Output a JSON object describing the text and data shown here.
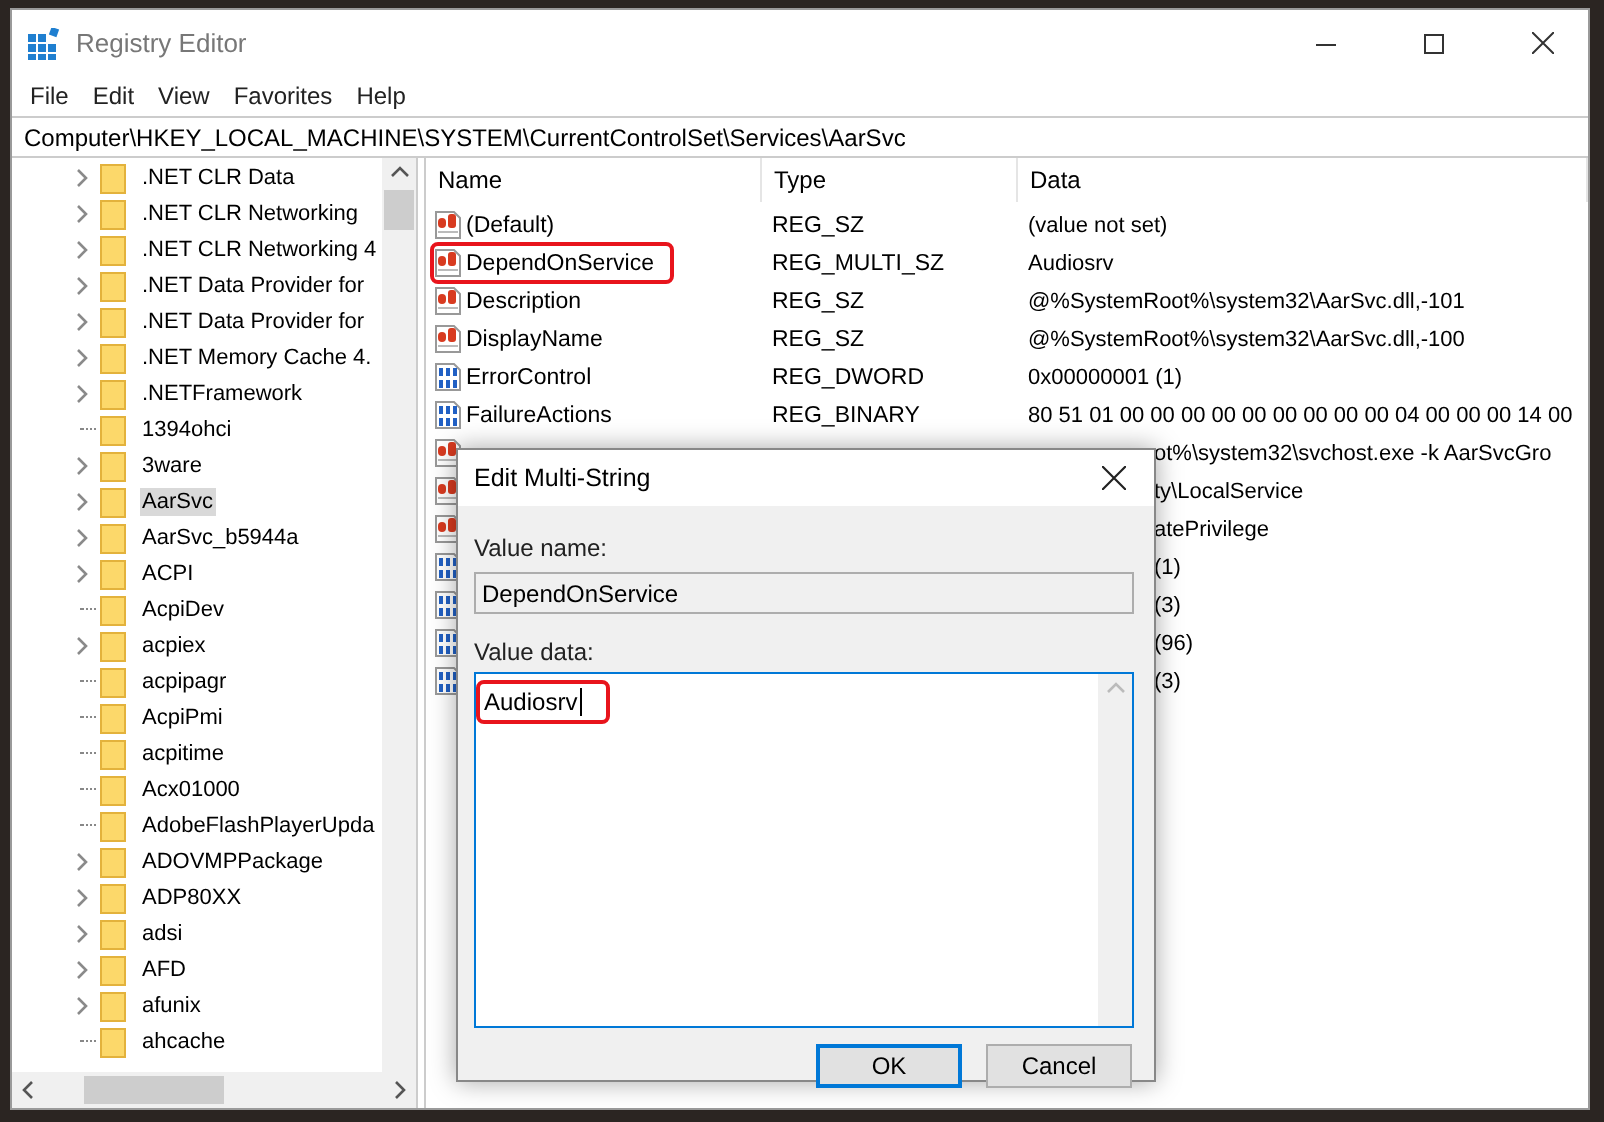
{
  "window": {
    "title": "Registry Editor"
  },
  "menu": [
    "File",
    "Edit",
    "View",
    "Favorites",
    "Help"
  ],
  "address": "Computer\\HKEY_LOCAL_MACHINE\\SYSTEM\\CurrentControlSet\\Services\\AarSvc",
  "tree": {
    "items": [
      {
        "label": ".NET CLR Data",
        "expandable": true,
        "selected": false
      },
      {
        "label": ".NET CLR Networking",
        "expandable": true,
        "selected": false
      },
      {
        "label": ".NET CLR Networking 4",
        "expandable": true,
        "selected": false
      },
      {
        "label": ".NET Data Provider for",
        "expandable": true,
        "selected": false
      },
      {
        "label": ".NET Data Provider for",
        "expandable": true,
        "selected": false
      },
      {
        "label": ".NET Memory Cache 4.",
        "expandable": true,
        "selected": false
      },
      {
        "label": ".NETFramework",
        "expandable": true,
        "selected": false
      },
      {
        "label": "1394ohci",
        "expandable": false,
        "selected": false
      },
      {
        "label": "3ware",
        "expandable": true,
        "selected": false
      },
      {
        "label": "AarSvc",
        "expandable": true,
        "selected": true
      },
      {
        "label": "AarSvc_b5944a",
        "expandable": true,
        "selected": false
      },
      {
        "label": "ACPI",
        "expandable": true,
        "selected": false
      },
      {
        "label": "AcpiDev",
        "expandable": false,
        "selected": false
      },
      {
        "label": "acpiex",
        "expandable": true,
        "selected": false
      },
      {
        "label": "acpipagr",
        "expandable": false,
        "selected": false
      },
      {
        "label": "AcpiPmi",
        "expandable": false,
        "selected": false
      },
      {
        "label": "acpitime",
        "expandable": false,
        "selected": false
      },
      {
        "label": "Acx01000",
        "expandable": false,
        "selected": false
      },
      {
        "label": "AdobeFlashPlayerUpda",
        "expandable": false,
        "selected": false
      },
      {
        "label": "ADOVMPPackage",
        "expandable": true,
        "selected": false
      },
      {
        "label": "ADP80XX",
        "expandable": true,
        "selected": false
      },
      {
        "label": "adsi",
        "expandable": true,
        "selected": false
      },
      {
        "label": "AFD",
        "expandable": true,
        "selected": false
      },
      {
        "label": "afunix",
        "expandable": true,
        "selected": false
      },
      {
        "label": "ahcache",
        "expandable": false,
        "selected": false
      }
    ]
  },
  "values": {
    "columns": [
      "Name",
      "Type",
      "Data"
    ],
    "rows": [
      {
        "kind": "string",
        "name": "(Default)",
        "type": "REG_SZ",
        "data": "(value not set)",
        "highlighted": false
      },
      {
        "kind": "string",
        "name": "DependOnService",
        "type": "REG_MULTI_SZ",
        "data": "Audiosrv",
        "highlighted": true
      },
      {
        "kind": "string",
        "name": "Description",
        "type": "REG_SZ",
        "data": "@%SystemRoot%\\system32\\AarSvc.dll,-101",
        "highlighted": false
      },
      {
        "kind": "string",
        "name": "DisplayName",
        "type": "REG_SZ",
        "data": "@%SystemRoot%\\system32\\AarSvc.dll,-100",
        "highlighted": false
      },
      {
        "kind": "binary",
        "name": "ErrorControl",
        "type": "REG_DWORD",
        "data": "0x00000001 (1)",
        "highlighted": false
      },
      {
        "kind": "binary",
        "name": "FailureActions",
        "type": "REG_BINARY",
        "data": "80 51 01 00 00 00 00 00 00 00 00 00 04 00 00 00 14 00",
        "highlighted": false
      },
      {
        "kind": "string",
        "data": "ot%\\system32\\svchost.exe -k AarSvcGro",
        "highlighted": false
      },
      {
        "kind": "string",
        "data": "ty\\LocalService",
        "highlighted": false
      },
      {
        "kind": "string",
        "data": "atePrivilege",
        "highlighted": false
      },
      {
        "kind": "binary",
        "data": "(1)",
        "highlighted": false
      },
      {
        "kind": "binary",
        "data": "(3)",
        "highlighted": false
      },
      {
        "kind": "binary",
        "data": "(96)",
        "highlighted": false
      },
      {
        "kind": "binary",
        "data": "(3)",
        "highlighted": false
      }
    ]
  },
  "dialog": {
    "title": "Edit Multi-String",
    "name_label": "Value name:",
    "name_value": "DependOnService",
    "data_label": "Value data:",
    "data_value": "Audiosrv",
    "data_highlighted": true,
    "buttons": [
      {
        "label": "OK",
        "default": true
      },
      {
        "label": "Cancel",
        "default": false
      }
    ]
  }
}
